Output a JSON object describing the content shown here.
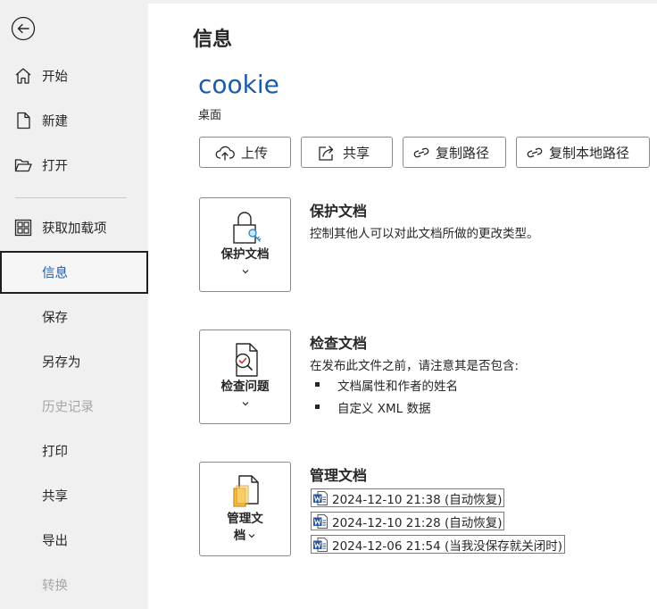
{
  "sidebar": {
    "back_icon": "back-arrow-icon",
    "items": [
      {
        "label": "开始",
        "icon": "home-icon"
      },
      {
        "label": "新建",
        "icon": "new-document-icon"
      },
      {
        "label": "打开",
        "icon": "open-folder-icon"
      },
      {
        "label": "获取加载项",
        "icon": "add-ins-grid-icon"
      },
      {
        "label": "信息",
        "selected": true
      },
      {
        "label": "保存"
      },
      {
        "label": "另存为"
      },
      {
        "label": "历史记录",
        "disabled": true
      },
      {
        "label": "打印"
      },
      {
        "label": "共享"
      },
      {
        "label": "导出"
      },
      {
        "label": "转换",
        "disabled": true
      }
    ]
  },
  "main": {
    "title": "信息",
    "document_name": "cookie",
    "document_location": "桌面",
    "actions": [
      {
        "label": "上传",
        "icon": "cloud-upload-icon"
      },
      {
        "label": "共享",
        "icon": "share-icon"
      },
      {
        "label": "复制路径",
        "icon": "link-icon"
      },
      {
        "label": "复制本地路径",
        "icon": "link-icon"
      }
    ],
    "sections": {
      "protect": {
        "button_label": "保护文档",
        "icon": "lock-key-icon",
        "title": "保护文档",
        "description": "控制其他人可以对此文档所做的更改类型。"
      },
      "inspect": {
        "button_label": "检查问题",
        "icon": "inspect-document-icon",
        "title": "检查文档",
        "description": "在发布此文件之前，请注意其是否包含:",
        "bullets": [
          "文档属性和作者的姓名",
          "自定义 XML 数据"
        ]
      },
      "manage": {
        "button_label_line1": "管理文",
        "button_label_line2": "档",
        "icon": "manage-document-icon",
        "title": "管理文档",
        "versions": [
          "2024-12-10 21:38 (自动恢复)",
          "2024-12-10 21:28 (自动恢复)",
          "2024-12-06 21:54 (当我没保存就关闭时)"
        ]
      }
    }
  },
  "colors": {
    "accent": "#1c5ba8",
    "sidebar_bg": "#f0f0f0",
    "word_blue": "#2b579a",
    "disabled_text": "#a6a6a6"
  }
}
